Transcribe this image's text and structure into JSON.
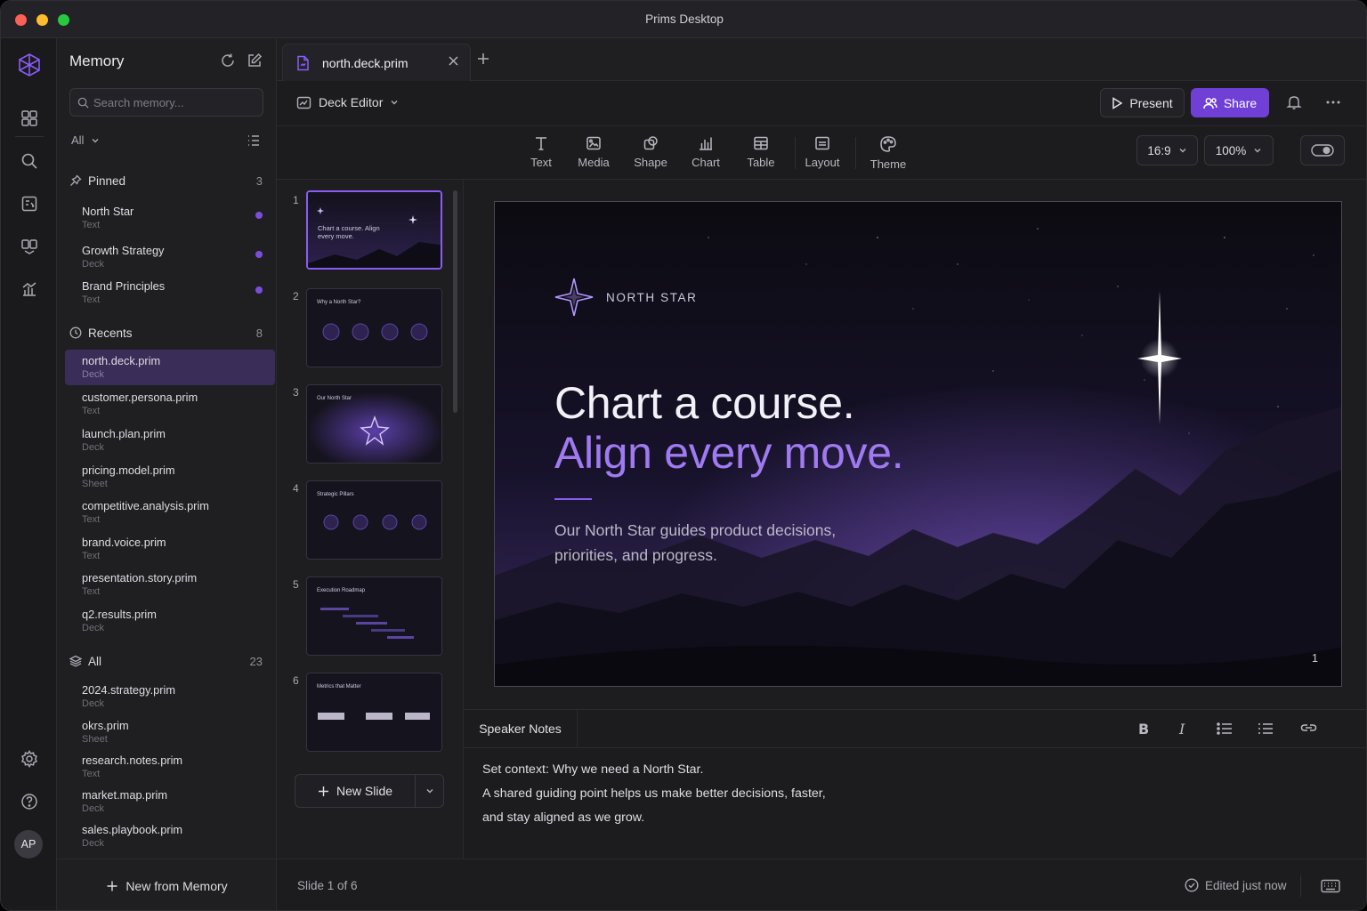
{
  "window": {
    "title": "Prims Desktop"
  },
  "rail": {
    "icons": [
      "logo-icon",
      "grid-icon",
      "search-icon",
      "memory-icon",
      "cards-icon",
      "chart-icon",
      "settings-icon",
      "help-icon"
    ],
    "avatar_initials": "AP"
  },
  "memory": {
    "title": "Memory",
    "search_placeholder": "Search memory...",
    "filter": "All",
    "pinned": {
      "label": "Pinned",
      "count": "3",
      "items": [
        {
          "name": "North Star",
          "type": "Text"
        },
        {
          "name": "Growth Strategy",
          "type": "Deck"
        },
        {
          "name": "Brand Principles",
          "type": "Text"
        }
      ]
    },
    "recents": {
      "label": "Recents",
      "count": "8",
      "items": [
        {
          "name": "north.deck.prim",
          "type": "Deck"
        },
        {
          "name": "customer.persona.prim",
          "type": "Text"
        },
        {
          "name": "launch.plan.prim",
          "type": "Deck"
        },
        {
          "name": "pricing.model.prim",
          "type": "Sheet"
        },
        {
          "name": "competitive.analysis.prim",
          "type": "Text"
        },
        {
          "name": "brand.voice.prim",
          "type": "Text"
        },
        {
          "name": "presentation.story.prim",
          "type": "Text"
        },
        {
          "name": "q2.results.prim",
          "type": "Deck"
        }
      ]
    },
    "all": {
      "label": "All",
      "count": "23",
      "items": [
        {
          "name": "2024.strategy.prim",
          "type": "Deck"
        },
        {
          "name": "okrs.prim",
          "type": "Sheet"
        },
        {
          "name": "research.notes.prim",
          "type": "Text"
        },
        {
          "name": "market.map.prim",
          "type": "Deck"
        },
        {
          "name": "sales.playbook.prim",
          "type": "Deck"
        }
      ]
    },
    "footer": "New from Memory"
  },
  "tab": {
    "label": "north.deck.prim"
  },
  "editor": {
    "mode": "Deck Editor",
    "present": "Present",
    "share": "Share",
    "tools": [
      {
        "label": "Text",
        "icon": "text-icon"
      },
      {
        "label": "Media",
        "icon": "media-icon"
      },
      {
        "label": "Shape",
        "icon": "shape-icon"
      },
      {
        "label": "Chart",
        "icon": "chart-icon"
      },
      {
        "label": "Table",
        "icon": "table-icon"
      },
      {
        "label": "Layout",
        "icon": "layout-icon"
      },
      {
        "label": "Theme",
        "icon": "theme-icon"
      }
    ],
    "aspect": "16:9",
    "zoom": "100%"
  },
  "slides": {
    "numbers": [
      "1",
      "2",
      "3",
      "4",
      "5",
      "6"
    ],
    "thumb_titles": [
      "Chart a course. Align every move.",
      "Why a North Star?",
      "Our North Star",
      "Strategic Pillars",
      "Execution Roadmap",
      "Metrics that Matter"
    ],
    "new_slide": "New Slide"
  },
  "slide": {
    "brand": "NORTH STAR",
    "headline": "Chart a course.",
    "headline_accent": "Align every move.",
    "body": "Our North Star guides product decisions, priorities, and progress.",
    "page": "1"
  },
  "notes": {
    "tab": "Speaker Notes",
    "lines": [
      "Set context: Why we need a North Star.",
      "A shared guiding point helps us make better decisions, faster,",
      "and stay aligned as we grow."
    ]
  },
  "status": {
    "position": "Slide 1 of 6",
    "edited": "Edited just now"
  },
  "colors": {
    "accent": "#6f3fd6",
    "accent_text": "#a07af0",
    "pin": "#7c4ddc"
  }
}
